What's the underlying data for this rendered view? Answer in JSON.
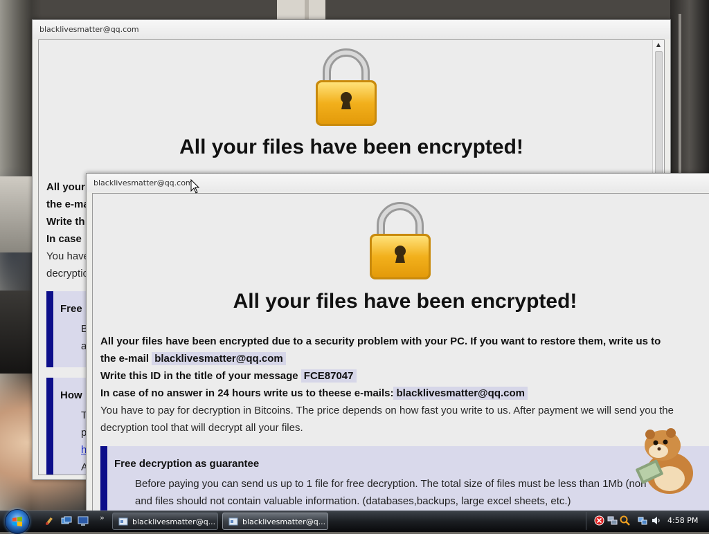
{
  "window_back": {
    "title": "blacklivesmatter@qq.com",
    "headline": "All your files have been encrypted!",
    "lines": [
      "All your",
      "the e-ma",
      "Write th",
      "In case",
      "You have",
      "decryptio"
    ],
    "panel1_title": "Free",
    "panel1_lines": [
      "B",
      "a"
    ],
    "panel2_title": "How",
    "panel2_lines": [
      "T",
      "p",
      "h",
      "A"
    ]
  },
  "window_front": {
    "title": "blacklivesmatter@qq.com",
    "headline": "All your files have been encrypted!",
    "line1": "All your files have been encrypted due to a security problem with your PC. If you want to restore them, write us to",
    "line2_prefix": "the e-mail",
    "email": "blacklivesmatter@qq.com",
    "line3_prefix": "Write this ID in the title of your message",
    "id": "FCE87047",
    "line4_prefix": "In case of no answer in 24 hours write us to theese e-mails:",
    "line5": "You have to pay for decryption in Bitcoins. The price depends on how fast you write to us. After payment we will send you the",
    "line6": "decryption tool that will decrypt all your files.",
    "guarantee_title": "Free decryption as guarantee",
    "guarantee_line1": "Before paying you can send us up to 1 file for free decryption. The total size of files must be less than 1Mb (non",
    "guarantee_line2": "and files should not contain valuable information. (databases,backups, large excel sheets, etc.)"
  },
  "taskbar": {
    "tasks": [
      {
        "label": "blacklivesmatter@q..."
      },
      {
        "label": "blacklivesmatter@q..."
      }
    ],
    "clock": "4:58 PM"
  },
  "colors": {
    "panel_accent": "#0d0f8a",
    "panel_bg": "#d9d9eb",
    "highlight_bg": "#d6d6e8",
    "lock_body": "#f2b01c"
  },
  "icons": [
    "lock-icon",
    "windows-start-icon",
    "show-desktop-icon",
    "switch-windows-icon",
    "hamster-icon",
    "cursor-icon"
  ]
}
